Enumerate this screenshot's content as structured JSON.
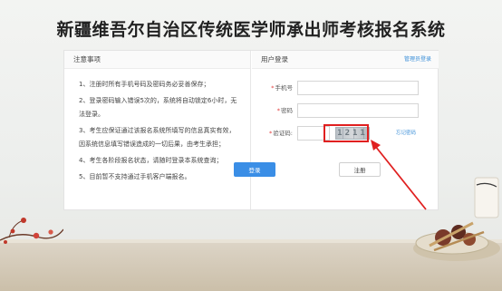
{
  "page": {
    "title": "新疆维吾尔自治区传统医学师承出师考核报名系统"
  },
  "notice": {
    "heading": "注意事项",
    "items": [
      "1、注册时所有手机号码及密码务必妥善保存；",
      "2、登录密码输入错误5次的，系统将自动锁定6小时，无法登录。",
      "3、考生应保证通过该报名系统所填写的信息真实有效，因系统信息填写错误造成的一切后果，由考生承担；",
      "4、考生各阶段报名状态，请随时登录本系统查询；",
      "5、目前暂不支持通过手机客户端报名。"
    ]
  },
  "login": {
    "heading": "用户登录",
    "admin_link": "管理员登录",
    "phone_label": "手机号",
    "password_label": "密码",
    "captcha_label": "验证码:",
    "captcha_value": "1211",
    "forgot_label": "忘记密码",
    "login_button": "登录",
    "register_button": "注册",
    "required_mark": "*"
  },
  "colors": {
    "accent": "#3a8ee6",
    "link": "#3b8fd8",
    "highlight": "#e02020",
    "required": "#e23b3b"
  },
  "icons": {
    "annotation_arrow": "red-arrow-icon",
    "decoration_left": "plum-blossom-icon",
    "decoration_right": "herbal-medicine-icon"
  }
}
